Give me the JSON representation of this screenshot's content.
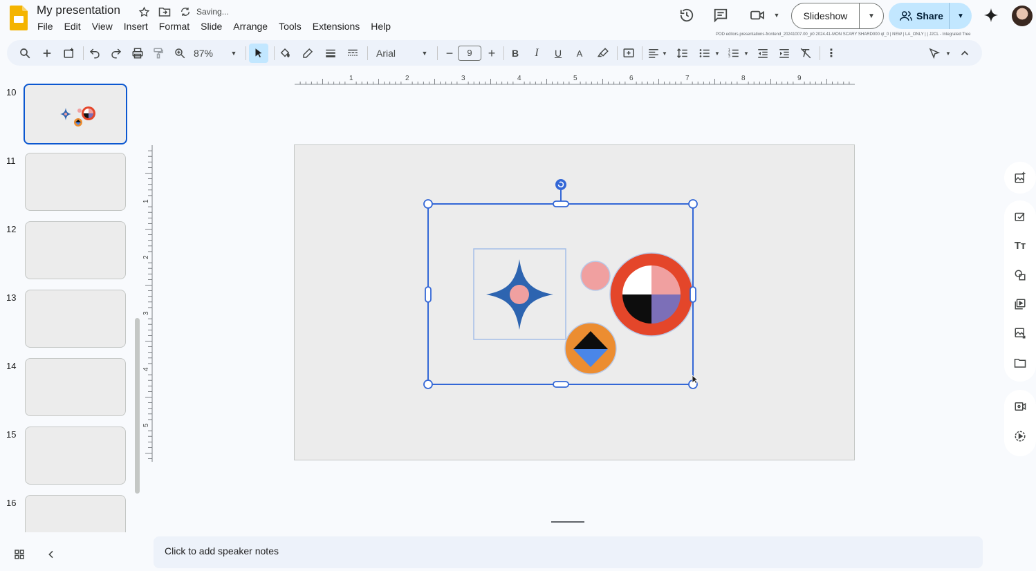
{
  "app": {
    "doc_title": "My presentation",
    "save_status": "Saving...",
    "menu": [
      "File",
      "Edit",
      "View",
      "Insert",
      "Format",
      "Slide",
      "Arrange",
      "Tools",
      "Extensions",
      "Help"
    ],
    "slideshow_label": "Slideshow",
    "share_label": "Share",
    "pod_info": "POD editors.presentations-frontend_20241007.00_p0 2024.41-MON SCARY SHARD000 qt_0 | NEW | LA_ONLY | | J2CL - Integrated Tree"
  },
  "toolbar": {
    "zoom": "87%",
    "font": "Arial",
    "font_size": "9"
  },
  "filmstrip": {
    "slides": [
      {
        "num": "10",
        "selected": true
      },
      {
        "num": "11",
        "selected": false
      },
      {
        "num": "12",
        "selected": false
      },
      {
        "num": "13",
        "selected": false
      },
      {
        "num": "14",
        "selected": false
      },
      {
        "num": "15",
        "selected": false
      },
      {
        "num": "16",
        "selected": false
      }
    ]
  },
  "ruler": {
    "h_labels": [
      "1",
      "2",
      "3",
      "4",
      "5",
      "6",
      "7",
      "8",
      "9"
    ],
    "v_labels": [
      "1",
      "2",
      "3",
      "4",
      "5"
    ]
  },
  "notes": {
    "placeholder": "Click to add speaker notes"
  },
  "colors": {
    "star_blue": "#2d64b0",
    "pink": "#f0a0a0",
    "red_ring": "#e4462a",
    "purple": "#7c6fb8",
    "orange": "#ec8d31",
    "light_blue": "#4a86e8",
    "selection": "#3367d6"
  }
}
